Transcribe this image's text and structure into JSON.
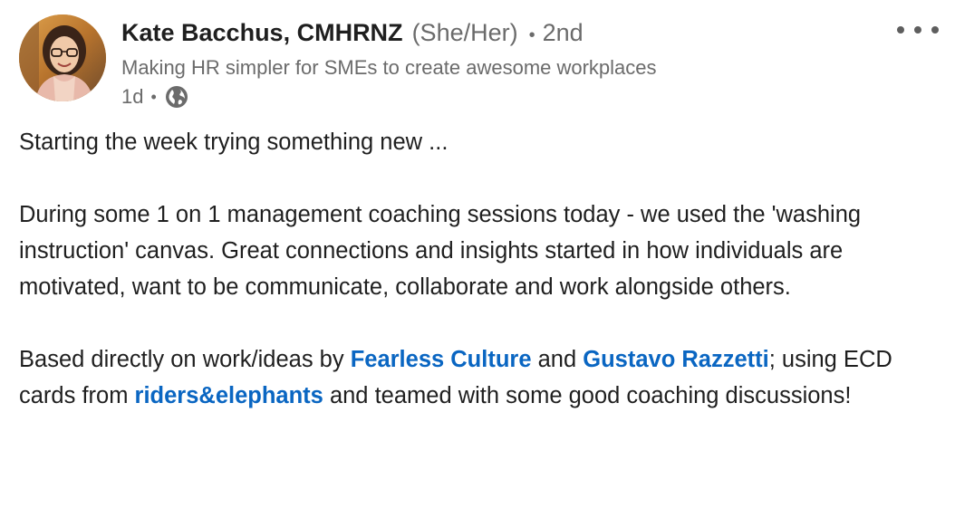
{
  "post": {
    "author": {
      "name": "Kate Bacchus, CMHRNZ",
      "pronouns": "(She/Her)",
      "separator": "•",
      "degree": "2nd",
      "headline": "Making HR simpler for SMEs to create awesome workplaces"
    },
    "meta": {
      "time": "1d",
      "separator": "•",
      "visibility_icon": "globe-icon"
    },
    "more_icon": "more-horizontal-icon",
    "body": {
      "p1": "Starting the week trying something new ...",
      "p2": "During some 1 on 1 management coaching sessions today - we used the 'washing instruction' canvas. Great connections and insights started in how individuals are motivated, want to be communicate, collaborate and work alongside others.",
      "p3_part1": "Based directly on work/ideas by ",
      "mention1": "Fearless Culture",
      "p3_part2": " and ",
      "mention2": "Gustavo Razzetti",
      "p3_part3": "; using ECD cards from ",
      "mention3": "riders&elephants",
      "p3_part4": " and teamed with some good coaching discussions!"
    },
    "colors": {
      "mention": "#0a66c2",
      "secondary_text": "#6b6b6b",
      "primary_text": "#1f1f1f"
    }
  }
}
